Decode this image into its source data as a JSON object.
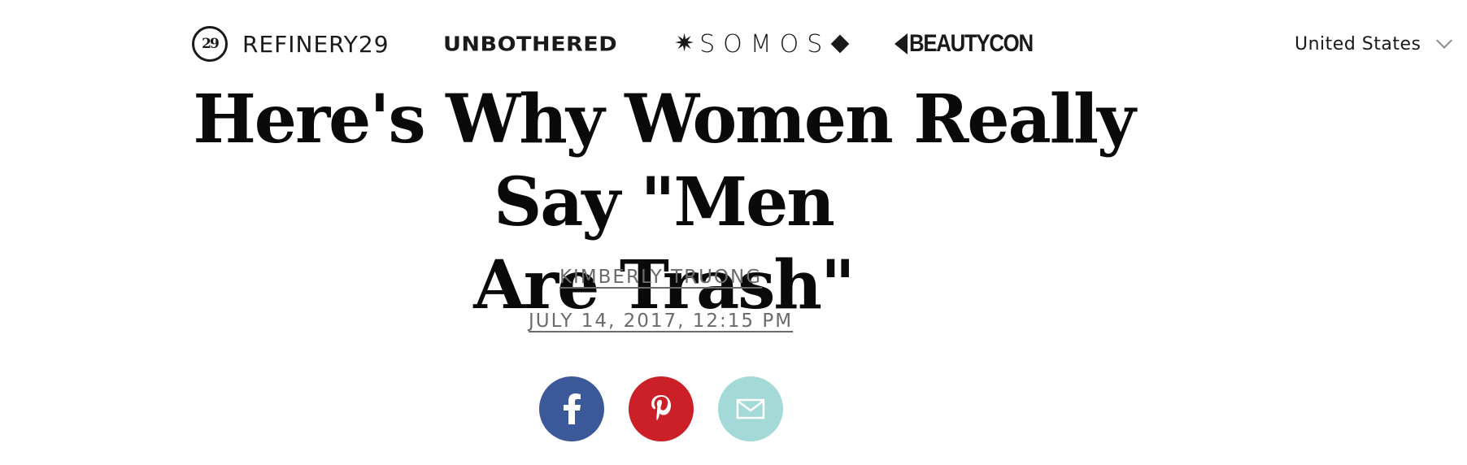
{
  "header": {
    "brands": {
      "refinery29_badge": "29",
      "refinery29": "REFINERY29",
      "unbothered": "UNBOTHERED",
      "somos": "SOMOS",
      "beautycon": "BEAUTYCON"
    },
    "region": "United States",
    "icons": [
      "refinery29-badge-icon",
      "somos-star-icon",
      "somos-diamond-icon",
      "beautycon-mark-icon",
      "chevron-down-icon"
    ]
  },
  "article": {
    "title_line1": "Here's Why Women Really Say \"Men",
    "title_line2": "Are Trash\"",
    "author": "KIMBERLY TRUONG",
    "date": "JULY 14, 2017, 12:15 PM"
  },
  "share": {
    "buttons": [
      {
        "name": "facebook",
        "icon": "facebook-icon",
        "color": "#3b5998"
      },
      {
        "name": "pinterest",
        "icon": "pinterest-icon",
        "color": "#cb2027"
      },
      {
        "name": "email",
        "icon": "mail-icon",
        "color": "#a3d9d7"
      }
    ]
  },
  "colors": {
    "text": "#0a0a0a",
    "meta": "#6b6b6b"
  }
}
